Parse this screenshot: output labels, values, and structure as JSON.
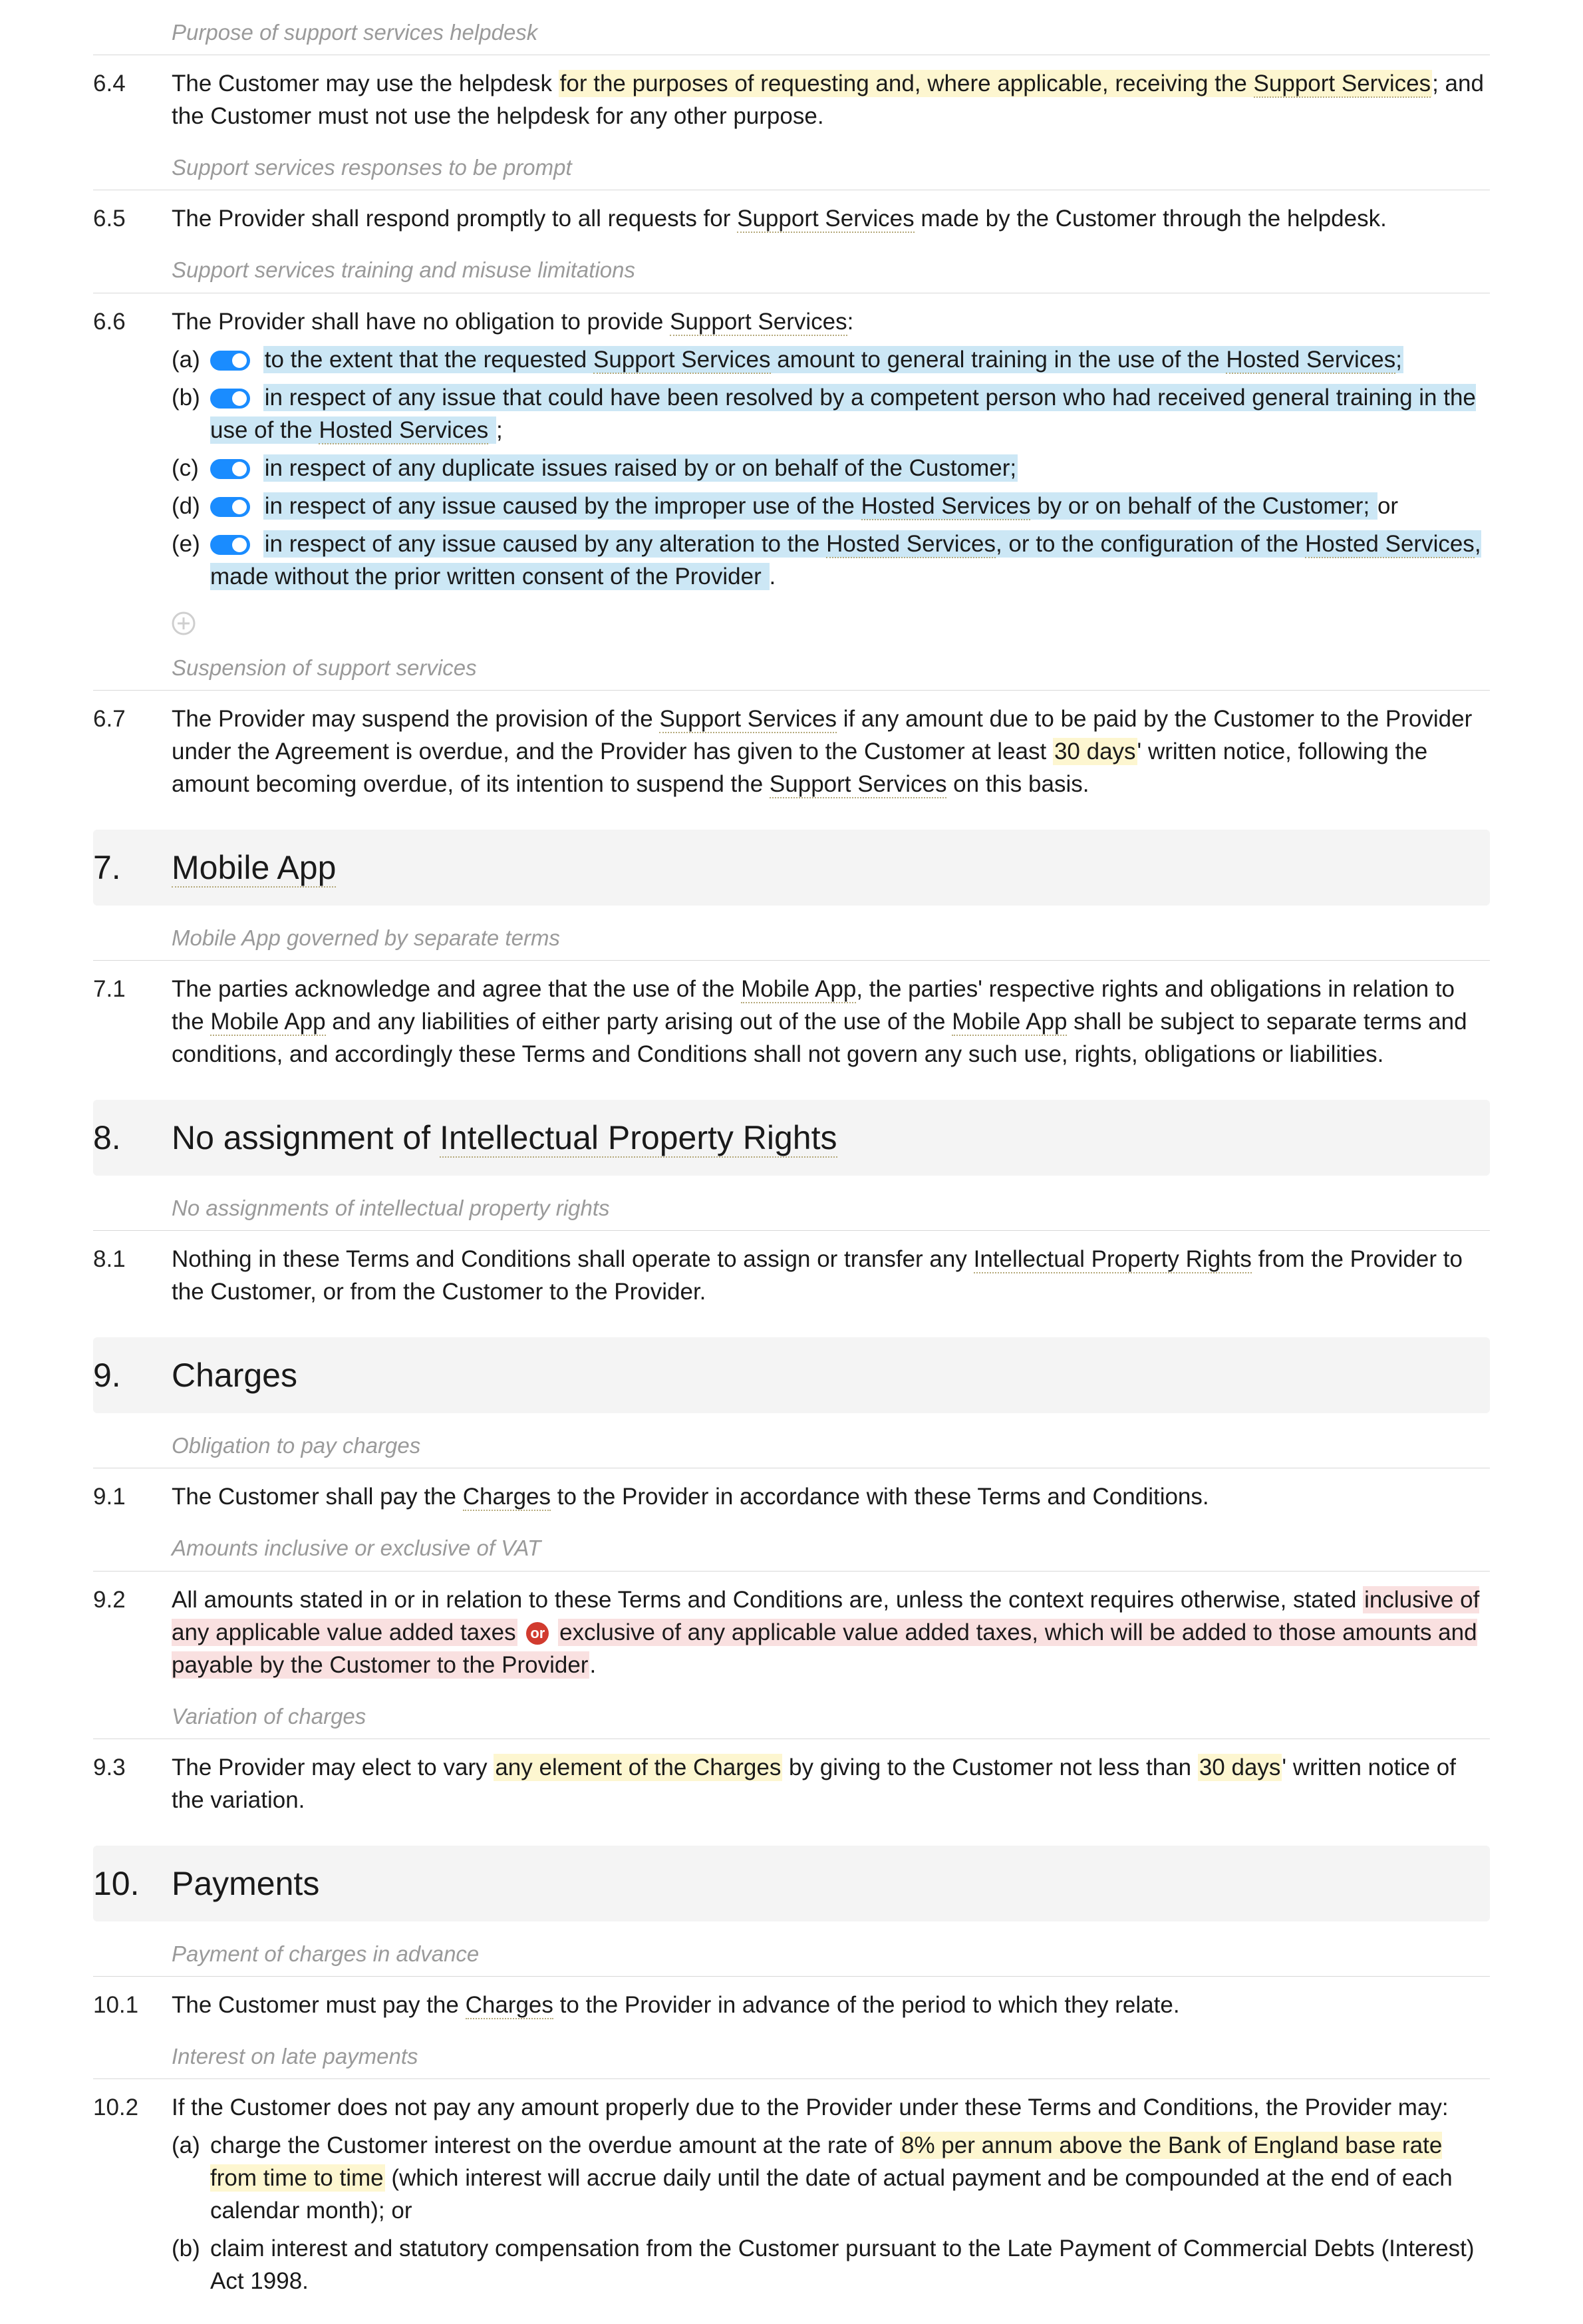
{
  "notes": {
    "n64pre": "Purpose of support services helpdesk",
    "n65pre": "Support services responses to be prompt",
    "n66pre": "Support services training and misuse limitations",
    "n67pre": "Suspension of support services",
    "n71pre": "Mobile App governed by separate terms",
    "n81pre": "No assignments of intellectual property rights",
    "n91pre": "Obligation to pay charges",
    "n92pre": "Amounts inclusive or exclusive of VAT",
    "n93pre": "Variation of charges",
    "n101pre": "Payment of charges in advance",
    "n102pre": "Interest on late payments"
  },
  "c64": {
    "num": "6.4",
    "t1": "The Customer may use the helpdesk ",
    "t_hl": "for the purposes of requesting and, where applicable, receiving the ",
    "t_term": "Support Services",
    "t2": "; and the Customer must not use the helpdesk for any other purpose."
  },
  "c65": {
    "num": "6.5",
    "t1": "The Provider shall respond promptly to all requests for ",
    "t_term": "Support Services",
    "t2": " made by the Customer through the helpdesk."
  },
  "c66": {
    "num": "6.6",
    "intro1": "The Provider shall have no obligation to provide ",
    "intro_term": "Support Services",
    "intro2": ":",
    "a": {
      "lbl": "(a)",
      "p1": "to the extent that the requested ",
      "term1": "Support Services",
      "p2": " amount to general training in the use of the ",
      "term2": "Hosted Services",
      "p3": ";"
    },
    "b": {
      "lbl": "(b)",
      "p1": "in respect of any issue that could have been resolved by a competent person who had received general training in the use of the ",
      "term1": "Hosted Services",
      "p2": ";"
    },
    "c": {
      "lbl": "(c)",
      "p1": "in respect of any duplicate issues raised by or on behalf of the Customer;"
    },
    "d": {
      "lbl": "(d)",
      "p1": "in respect of any issue caused by the improper use of the ",
      "term1": "Hosted Services",
      "p2": " by or on behalf of the Customer;",
      "tail": " or"
    },
    "e": {
      "lbl": "(e)",
      "p1": "in respect of any issue caused by any alteration to the ",
      "term1": "Hosted Services",
      "p2": ", or to the configuration of the ",
      "term2": "Hosted Services",
      "p3": ", made without the prior written consent of the Provider",
      "tail": "."
    }
  },
  "c67": {
    "num": "6.7",
    "t1": "The Provider may suspend the provision of the ",
    "term1": "Support Services",
    "t2": " if any amount due to be paid by the Customer to the Provider under the Agreement is overdue, and the Provider has given to the Customer at least ",
    "hl": "30 days",
    "t3": "' written notice, following the amount becoming overdue, of its intention to suspend the ",
    "term2": "Support Services",
    "t4": " on this basis."
  },
  "s7": {
    "num": "7.",
    "title": "Mobile App"
  },
  "c71": {
    "num": "7.1",
    "t1": "The parties acknowledge and agree that the use of the ",
    "term1": "Mobile App",
    "t2": ", the parties' respective rights and obligations in relation to the ",
    "term2": "Mobile App",
    "t3": " and any liabilities of either party arising out of the use of the ",
    "term3": "Mobile App",
    "t4": " shall be subject to separate terms and conditions, and accordingly these Terms and Conditions shall not govern any such use, rights, obligations or liabilities."
  },
  "s8": {
    "num": "8.",
    "title_pre": "No assignment of ",
    "title_term": "Intellectual Property Rights"
  },
  "c81": {
    "num": "8.1",
    "t1": "Nothing in these Terms and Conditions shall operate to assign or transfer any ",
    "term1": "Intellectual Property Rights",
    "t2": " from the Provider to the Customer, or from the Customer to the Provider."
  },
  "s9": {
    "num": "9.",
    "title": "Charges"
  },
  "c91": {
    "num": "9.1",
    "t1": "The Customer shall pay the ",
    "term1": "Charges",
    "t2": " to the Provider in accordance with these Terms and Conditions."
  },
  "c92": {
    "num": "9.2",
    "t1": "All amounts stated in or in relation to these Terms and Conditions are, unless the context requires otherwise, stated ",
    "hl1": "inclusive of any applicable value added taxes",
    "or": "or",
    "hl2": "exclusive of any applicable value added taxes, which will be added to those amounts and payable by the Customer to the Provider",
    "t2": "."
  },
  "c93": {
    "num": "9.3",
    "t1": "The Provider may elect to vary ",
    "hl1": "any element of the Charges",
    "t2": " by giving to the Customer not less than ",
    "hl2": "30 days",
    "t3": "' written notice of the variation."
  },
  "s10": {
    "num": "10.",
    "title": "Payments"
  },
  "c101": {
    "num": "10.1",
    "t1": "The Customer must pay the ",
    "term1": "Charges",
    "t2": " to the Provider in advance of the period to which they relate."
  },
  "c102": {
    "num": "10.2",
    "intro": "If the Customer does not pay any amount properly due to the Provider under these Terms and Conditions, the Provider may:",
    "a": {
      "lbl": "(a)",
      "p1": "charge the Customer interest on the overdue amount at the rate of ",
      "hl": "8% per annum above the Bank of England base rate from time to time",
      "p2": " (which interest will accrue daily until the date of actual payment and be compounded at the end of each calendar month); or"
    },
    "b": {
      "lbl": "(b)",
      "p1": "claim interest and statutory compensation from the Customer pursuant to the Late Payment of Commercial Debts (Interest) Act 1998."
    }
  }
}
